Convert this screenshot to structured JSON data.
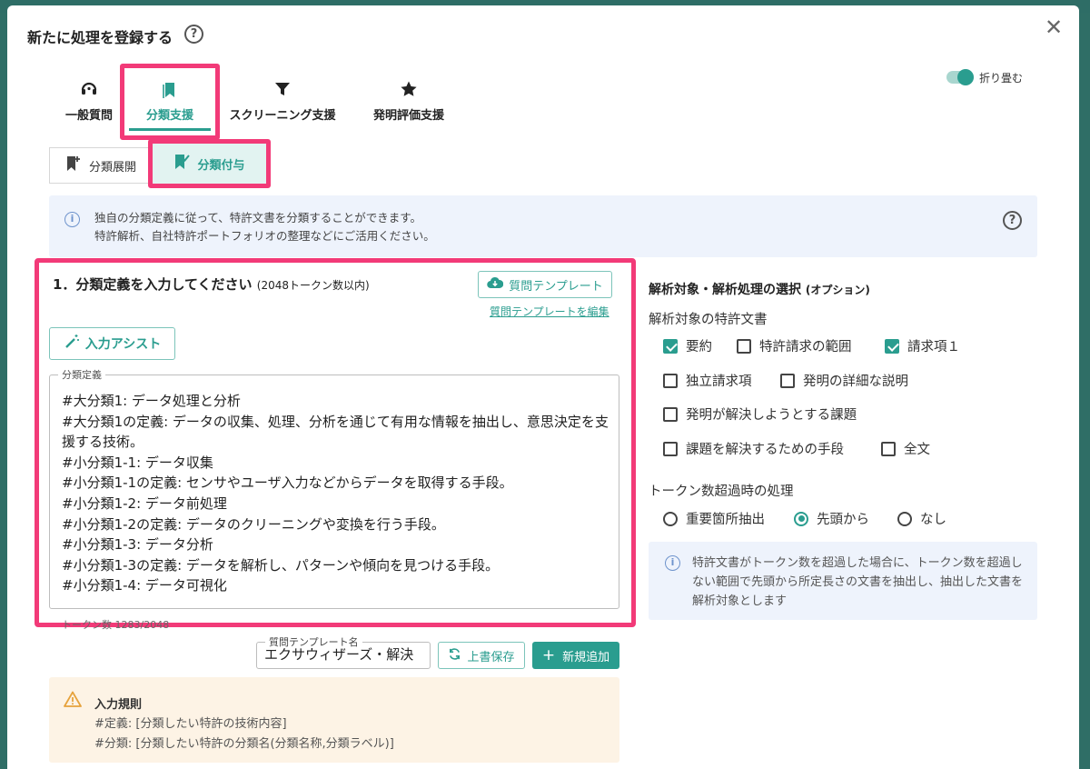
{
  "dialog": {
    "title": "新たに処理を登録する",
    "help_glyph": "?",
    "close_glyph": "✕",
    "collapse_toggle": {
      "label": "折り畳む",
      "on": true
    }
  },
  "tabs": [
    {
      "label": "一般質問",
      "icon": "headset-icon"
    },
    {
      "label": "分類支援",
      "icon": "bookmarks-icon",
      "active": true
    },
    {
      "label": "スクリーニング支援",
      "icon": "filter-icon"
    },
    {
      "label": "発明評価支援",
      "icon": "star-icon"
    }
  ],
  "subtabs": [
    {
      "label": "分類展開",
      "icon": "bookmark-plus-icon"
    },
    {
      "label": "分類付与",
      "icon": "bookmark-check-icon",
      "active": true
    }
  ],
  "info": {
    "line1": "独自の分類定義に従って、特許文書を分類することができます。",
    "line2": "特許解析、自社特許ポートフォリオの整理などにご活用ください。"
  },
  "section1": {
    "title": "1．分類定義を入力してください",
    "title_note": "(2048トークン数以内)",
    "template_button": "質問テンプレート",
    "edit_template_link": "質問テンプレートを編集",
    "assist_button": "入力アシスト",
    "field_label": "分類定義",
    "field_value": "#大分類1: データ処理と分析\n#大分類1の定義: データの収集、処理、分析を通じて有用な情報を抽出し、意思決定を支援する技術。\n#小分類1-1: データ収集\n#小分類1-1の定義: センサやユーザ入力などからデータを取得する手段。\n#小分類1-2: データ前処理\n#小分類1-2の定義: データのクリーニングや変換を行う手段。\n#小分類1-3: データ分析\n#小分類1-3の定義: データを解析し、パターンや傾向を見つける手段。\n#小分類1-4: データ可視化",
    "token_count": "トークン数 1283/2048"
  },
  "template_name": {
    "label": "質問テンプレート名",
    "value": "エクサウィザーズ・解決",
    "overwrite_button": "上書保存",
    "add_button": "新規追加"
  },
  "rules": {
    "title": "入力規則",
    "line1": "#定義: [分類したい特許の技術内容]",
    "line2": "#分類: [分類したい特許の分類名(分類名称,分類ラベル)]"
  },
  "right": {
    "title": "解析対象・解析処理の選択",
    "title_note": "(オプション)",
    "docs_label": "解析対象の特許文書",
    "checkboxes": [
      {
        "label": "要約",
        "checked": true
      },
      {
        "label": "特許請求の範囲",
        "checked": false
      },
      {
        "label": "請求項１",
        "checked": true
      },
      {
        "label": "独立請求項",
        "checked": false
      },
      {
        "label": "発明の詳細な説明",
        "checked": false
      },
      {
        "label": "発明が解決しようとする課題",
        "checked": false
      },
      {
        "label": "課題を解決するための手段",
        "checked": false
      },
      {
        "label": "全文",
        "checked": false
      }
    ],
    "overflow_label": "トークン数超過時の処理",
    "radios": [
      {
        "label": "重要箇所抽出",
        "selected": false
      },
      {
        "label": "先頭から",
        "selected": true
      },
      {
        "label": "なし",
        "selected": false
      }
    ],
    "note": "特許文書がトークン数を超過した場合に、トークン数を超過しない範囲で先頭から所定長さの文書を抽出し、抽出した文書を解析対象とします"
  },
  "colors": {
    "accent": "#2a9d8f",
    "highlight": "#f23a78",
    "info_bg": "#eef3fc",
    "warn_bg": "#fdf3e5"
  }
}
